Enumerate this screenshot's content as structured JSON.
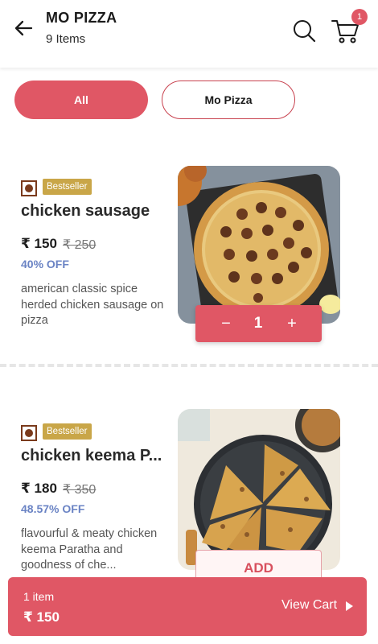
{
  "header": {
    "title": "MO PIZZA",
    "subtitle": "9 Items",
    "cart_badge": "1"
  },
  "filters": {
    "all": "All",
    "mo_pizza": "Mo Pizza"
  },
  "items": [
    {
      "badge": "Bestseller",
      "name": "chicken sausage",
      "price": "₹ 150",
      "mrp": "₹ 250",
      "discount": "40% OFF",
      "description": "american classic spice herded chicken sausage on pizza",
      "quantity": "1",
      "minus": "−",
      "plus": "+"
    },
    {
      "badge": "Bestseller",
      "name": "chicken keema P...",
      "price": "₹ 180",
      "mrp": "₹ 350",
      "discount": "48.57% OFF",
      "description": "flavourful & meaty chicken keema Paratha and goodness of che...",
      "add_label": "ADD"
    }
  ],
  "cart_bar": {
    "count": "1 item",
    "total": "₹ 150",
    "view_label": "View Cart"
  },
  "colors": {
    "accent": "#e05765",
    "bestseller": "#c9a648",
    "discount": "#6a83c4"
  }
}
